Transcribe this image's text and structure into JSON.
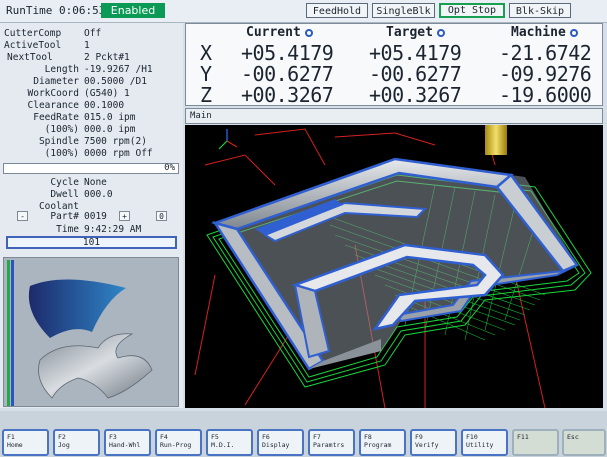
{
  "topbar": {
    "runtime_label": "RunTime",
    "runtime_value": "0:06:53",
    "status": "Enabled",
    "buttons": [
      "FeedHold",
      "SingleBlk",
      "Opt Stop",
      "Blk-Skip"
    ]
  },
  "params": [
    {
      "label": "CutterComp",
      "value": "Off"
    },
    {
      "label": "ActiveTool",
      "value": "1"
    },
    {
      "label": "NextTool",
      "value": "2  Pckt#1"
    },
    {
      "label": "Length",
      "value": "-19.9267 /H1"
    },
    {
      "label": "Diameter",
      "value": "00.5000 /D1"
    },
    {
      "label": "WorkCoord",
      "value": "(G540) 1"
    },
    {
      "label": "Clearance",
      "value": "00.1000"
    },
    {
      "label": "FeedRate",
      "value": "015.0 ipm"
    },
    {
      "label": "(100%)",
      "value": "000.0 ipm"
    },
    {
      "label": "Spindle",
      "value": "7500 rpm(2)"
    },
    {
      "label": "(100%)",
      "value": "0000 rpm Off"
    }
  ],
  "progress_text": "0%",
  "params2": [
    {
      "label": "Cycle",
      "value": "None"
    },
    {
      "label": "Dwell",
      "value": "000.0"
    },
    {
      "label": "Coolant",
      "value": ""
    }
  ],
  "part": {
    "label": "Part#",
    "value": "0019",
    "minus": "-",
    "plus": "+",
    "reset": "0"
  },
  "time": {
    "label": "Time",
    "value": "9:42:29 AM"
  },
  "line_number": "101",
  "dro": {
    "headers": [
      "Current",
      "Target",
      "Machine"
    ],
    "rows": [
      {
        "axis": "X",
        "current": "+05.4179",
        "target": "+05.4179",
        "machine": "-21.6742"
      },
      {
        "axis": "Y",
        "current": "-00.6277",
        "target": "-00.6277",
        "machine": "-09.9276"
      },
      {
        "axis": "Z",
        "current": "+00.3267",
        "target": "+00.3267",
        "machine": "-19.6000"
      }
    ]
  },
  "main_label": "Main",
  "fkeys": [
    {
      "key": "F1",
      "label": "Home"
    },
    {
      "key": "F2",
      "label": "Jog"
    },
    {
      "key": "F3",
      "label": "Hand-Whl"
    },
    {
      "key": "F4",
      "label": "Run-Prog"
    },
    {
      "key": "F5",
      "label": "M.D.I."
    },
    {
      "key": "F6",
      "label": "Display"
    },
    {
      "key": "F7",
      "label": "Paramtrs"
    },
    {
      "key": "F8",
      "label": "Program"
    },
    {
      "key": "F9",
      "label": "Verify"
    },
    {
      "key": "F10",
      "label": "Utility"
    },
    {
      "key": "F11",
      "label": ""
    },
    {
      "key": "Esc",
      "label": ""
    }
  ],
  "colors": {
    "enabled": "#0a9a55",
    "accent": "#3f63b8",
    "toolpath": "#19d43c",
    "rapid": "#d42020"
  }
}
